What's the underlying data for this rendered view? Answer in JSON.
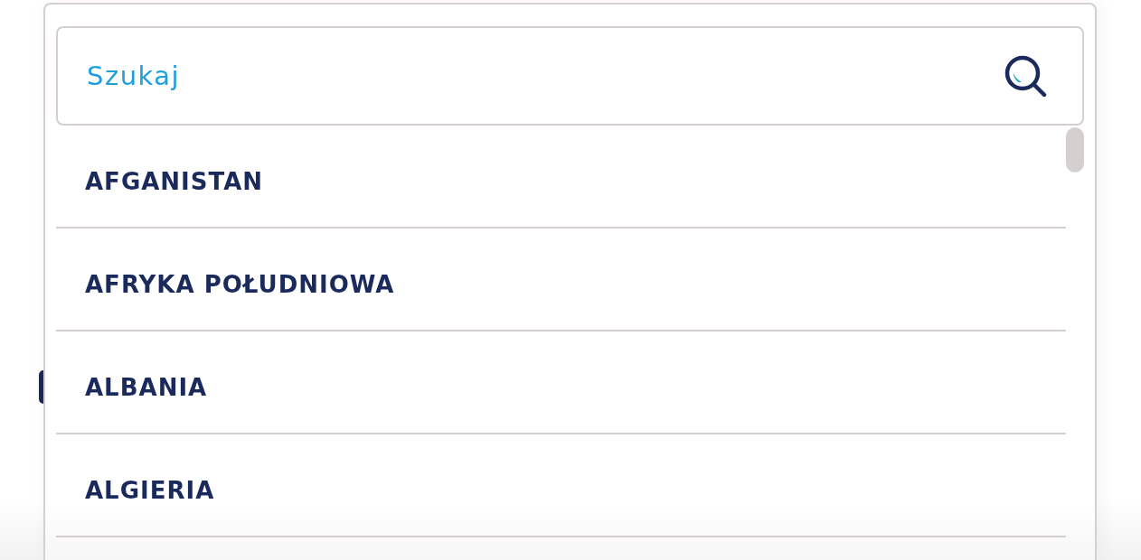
{
  "search": {
    "placeholder": "Szukaj"
  },
  "options": [
    {
      "label": "AFGANISTAN"
    },
    {
      "label": "AFRYKA POŁUDNIOWA"
    },
    {
      "label": "ALBANIA"
    },
    {
      "label": "ALGIERIA"
    }
  ]
}
